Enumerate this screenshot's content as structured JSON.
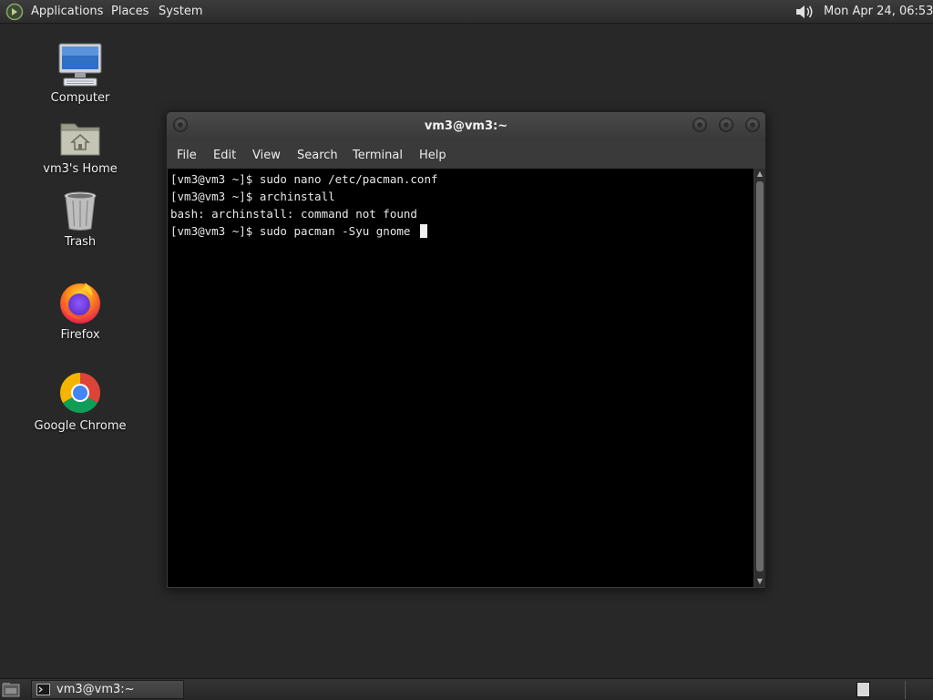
{
  "top_panel": {
    "menus": [
      "Applications",
      "Places",
      "System"
    ],
    "clock": "Mon Apr 24, 06:53"
  },
  "desktop": {
    "icons": [
      {
        "label": "Computer",
        "icon": "computer-icon"
      },
      {
        "label": "vm3's Home",
        "icon": "home-folder-icon"
      },
      {
        "label": "Trash",
        "icon": "trash-icon"
      },
      {
        "label": "Firefox",
        "icon": "firefox-icon"
      },
      {
        "label": "Google Chrome",
        "icon": "chrome-icon"
      }
    ]
  },
  "terminal": {
    "title": "vm3@vm3:~",
    "menu": [
      "File",
      "Edit",
      "View",
      "Search",
      "Terminal",
      "Help"
    ],
    "lines": [
      "[vm3@vm3 ~]$ sudo nano /etc/pacman.conf",
      "[vm3@vm3 ~]$ archinstall",
      "bash: archinstall: command not found",
      "[vm3@vm3 ~]$ sudo pacman -Syu gnome "
    ]
  },
  "taskbar": {
    "tasks": [
      {
        "label": "vm3@vm3:~",
        "icon": "terminal-icon"
      }
    ]
  },
  "colors": {
    "desktop_bg": "#282828",
    "terminal_bg": "#000000",
    "terminal_fg": "#e8e8e8",
    "chrome_red": "#db4437",
    "chrome_green": "#0f9d58",
    "chrome_yellow": "#f4b400",
    "chrome_blue": "#4285f4"
  }
}
